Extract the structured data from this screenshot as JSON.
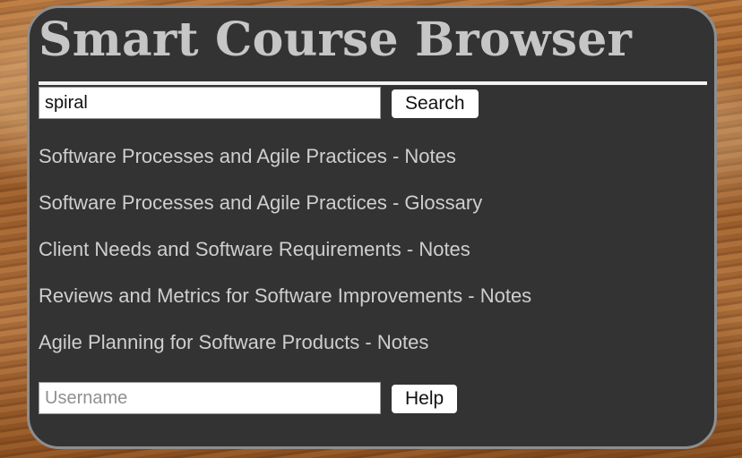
{
  "app": {
    "title": "Smart Course Browser"
  },
  "search": {
    "value": "spiral",
    "placeholder": "",
    "button_label": "Search"
  },
  "results": [
    {
      "label": "Software Processes and Agile Practices - Notes"
    },
    {
      "label": "Software Processes and Agile Practices - Glossary"
    },
    {
      "label": "Client Needs and Software Requirements - Notes"
    },
    {
      "label": "Reviews and Metrics for Software Improvements - Notes"
    },
    {
      "label": "Agile Planning for Software Products - Notes"
    }
  ],
  "user": {
    "value": "",
    "placeholder": "Username",
    "button_label": "Help"
  },
  "colors": {
    "panel": "#333333",
    "title": "#c6c6c6",
    "link": "#cfcfcf"
  }
}
